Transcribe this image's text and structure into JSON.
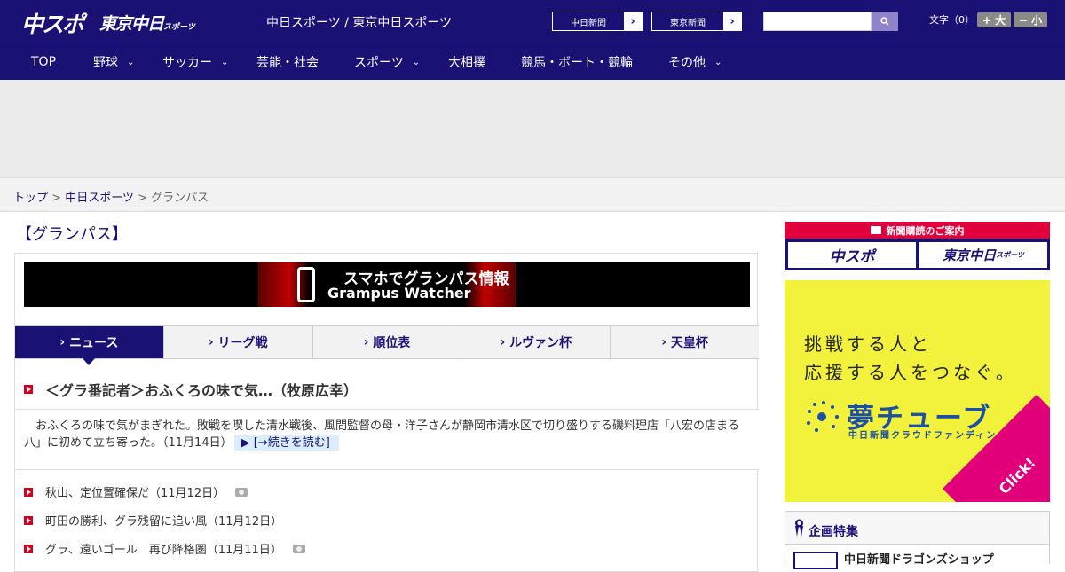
{
  "header": {
    "logo_chuspo": "中スポ",
    "logo_tokyo": "東京中日",
    "logo_tokyo_sub": "スポーツ",
    "site_names": "中日スポーツ / 東京中日スポーツ",
    "links": [
      {
        "label": "中日新聞"
      },
      {
        "label": "東京新聞"
      }
    ],
    "search": {
      "placeholder": ""
    },
    "font_size_label": "文字（0）",
    "font_bigger": "+ 大",
    "font_smaller": "− 小"
  },
  "nav": {
    "items": [
      {
        "label": "TOP",
        "has_dropdown": false
      },
      {
        "label": "野球",
        "has_dropdown": true
      },
      {
        "label": "サッカー",
        "has_dropdown": true
      },
      {
        "label": "芸能・社会",
        "has_dropdown": false
      },
      {
        "label": "スポーツ",
        "has_dropdown": true
      },
      {
        "label": "大相撲",
        "has_dropdown": false
      },
      {
        "label": "競馬・ボート・競輪",
        "has_dropdown": false
      },
      {
        "label": "その他",
        "has_dropdown": true
      }
    ],
    "chevron": "⌄"
  },
  "breadcrumb": {
    "items": [
      "トップ",
      "中日スポーツ",
      "グランパス"
    ],
    "separator": " > "
  },
  "main": {
    "section_title": "【グランパス】",
    "banner": {
      "line1": "スマホでグランパス情報",
      "line2": "Grampus Watcher"
    },
    "tabs": [
      {
        "label": "ニュース",
        "active": true
      },
      {
        "label": "リーグ戦",
        "active": false
      },
      {
        "label": "順位表",
        "active": false
      },
      {
        "label": "ルヴァン杯",
        "active": false
      },
      {
        "label": "天皇杯",
        "active": false
      }
    ],
    "tab_marker": "›",
    "headline": "＜グラ番記者＞おふくろの味で気…（牧原広幸）",
    "lede": "　おふくろの味で気がまぎれた。敗戦を喫した清水戦後、風間監督の母・洋子さんが静岡市清水区で切り盛りする磯料理店「八宏の店まる八」に初めて立ち寄った。（11月14日）",
    "read_more": "▶ [→続きを読む]",
    "news": [
      {
        "title": "秋山、定位置確保だ（11月12日）",
        "has_photo": true
      },
      {
        "title": "町田の勝利、グラ残留に追い風（11月12日）",
        "has_photo": false
      },
      {
        "title": "グラ、遠いゴール　再び降格圏（11月11日）",
        "has_photo": true
      }
    ]
  },
  "sidebar": {
    "subscription": {
      "heading": "新聞購読のご案内",
      "buttons": [
        "中スポ",
        "東京中日"
      ],
      "button2_sub": "スポーツ"
    },
    "yume_ad": {
      "line1": "挑戦する人と",
      "line2": "応援する人をつなぐ。",
      "brand": "夢チューブ",
      "sub": "中日新聞クラウドファンディング",
      "click": "Click!",
      "bg_color": "#f2f23c",
      "accent_color": "#e2007a"
    },
    "feature": {
      "title": "企画特集",
      "item": "中日新聞ドラゴンズショップ"
    }
  },
  "colors": {
    "brand_navy": "#1a1175",
    "accent_red": "#d0001e",
    "subscription_red": "#e2003c"
  }
}
